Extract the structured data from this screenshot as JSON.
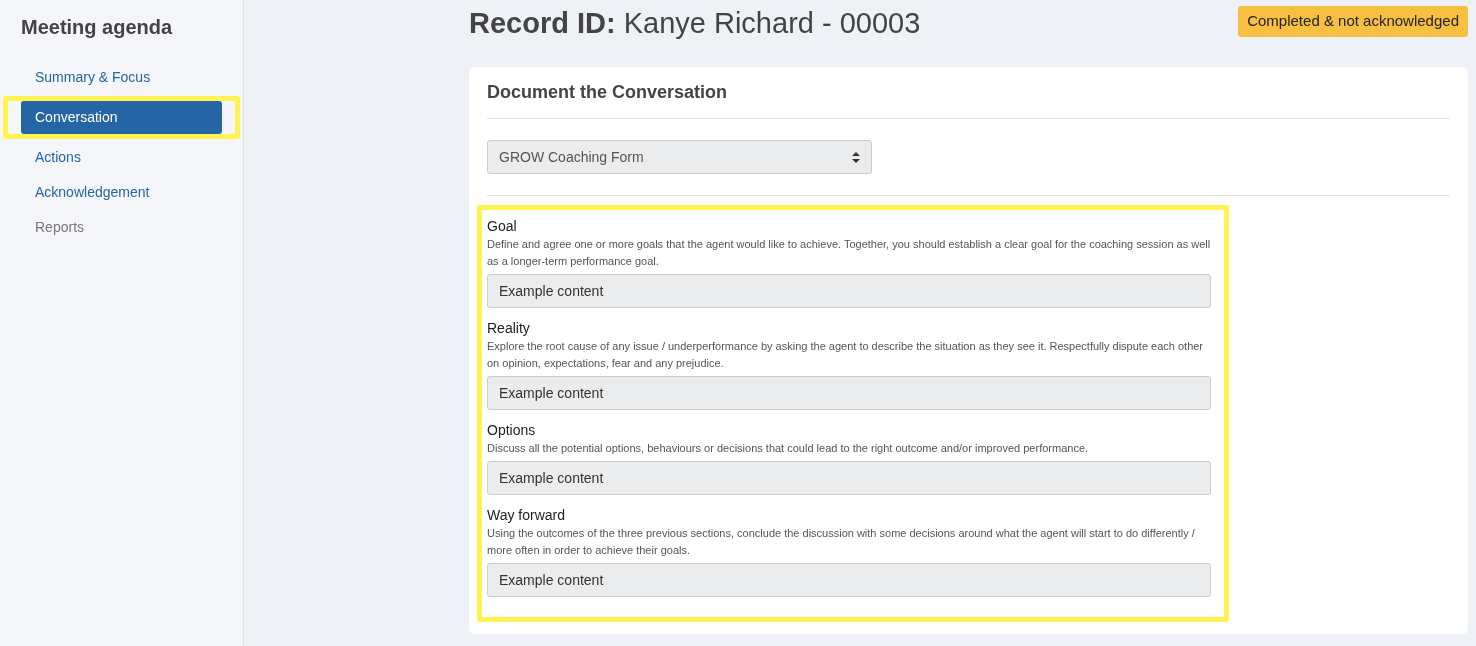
{
  "sidebar": {
    "title": "Meeting agenda",
    "items": [
      {
        "label": "Summary & Focus",
        "selected": false,
        "disabled": false,
        "highlighted": false
      },
      {
        "label": "Conversation",
        "selected": true,
        "disabled": false,
        "highlighted": true
      },
      {
        "label": "Actions",
        "selected": false,
        "disabled": false,
        "highlighted": false
      },
      {
        "label": "Acknowledgement",
        "selected": false,
        "disabled": false,
        "highlighted": false
      },
      {
        "label": "Reports",
        "selected": false,
        "disabled": true,
        "highlighted": false
      }
    ]
  },
  "header": {
    "title_label": "Record ID:",
    "title_value": "Kanye Richard - 00003",
    "status_badge": "Completed & not acknowledged"
  },
  "card": {
    "title": "Document the Conversation",
    "form_select": "GROW Coaching Form",
    "fields_highlighted": true,
    "fields": [
      {
        "label": "Goal",
        "description": "Define and agree one or more goals that the agent would like to achieve. Together, you should establish a clear goal for the coaching session as well as a longer-term performance goal.",
        "value": "Example content"
      },
      {
        "label": "Reality",
        "description": "Explore the root cause of any issue / underperformance by asking the agent to describe the situation as they see it. Respectfully dispute each other on opinion, expectations, fear and any prejudice.",
        "value": "Example content"
      },
      {
        "label": "Options",
        "description": "Discuss all the potential options, behaviours or decisions that could lead to the right outcome and/or improved performance.",
        "value": "Example content"
      },
      {
        "label": "Way forward",
        "description": "Using the outcomes of the three previous sections, conclude the discussion with some decisions around what the agent will start to do differently / more often in order to achieve their goals.",
        "value": "Example content"
      }
    ]
  }
}
